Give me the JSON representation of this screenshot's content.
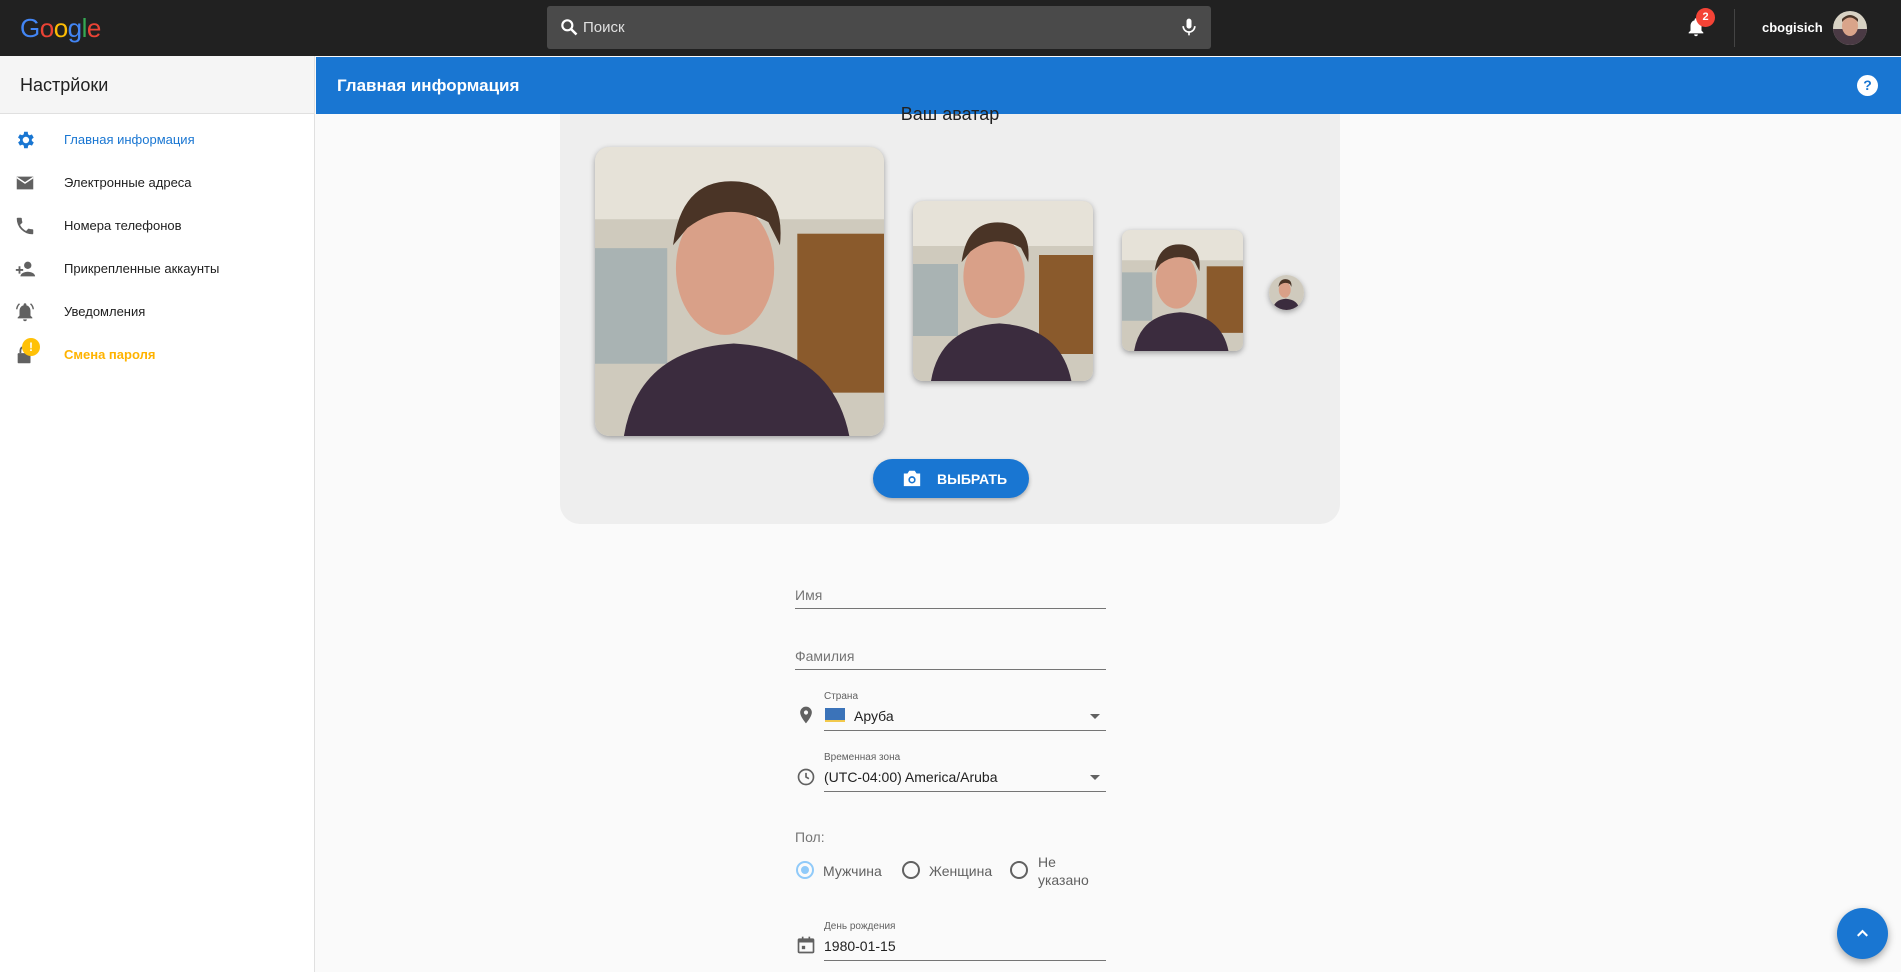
{
  "header": {
    "logo": "Google",
    "search_placeholder": "Поиск",
    "notification_count": "2",
    "username": "cbogisich"
  },
  "sidebar": {
    "title": "Настрйоки",
    "items": [
      {
        "label": "Главная информация",
        "icon": "gear-icon"
      },
      {
        "label": "Электронные адреса",
        "icon": "mail-icon"
      },
      {
        "label": "Номера телефонов",
        "icon": "phone-icon"
      },
      {
        "label": "Прикрепленные аккаунты",
        "icon": "person-add-icon"
      },
      {
        "label": "Уведомления",
        "icon": "bell-ring-icon"
      },
      {
        "label": "Смена пароля",
        "icon": "lock-icon",
        "warning": "!"
      }
    ]
  },
  "page": {
    "title": "Главная информация",
    "help": "?"
  },
  "avatar": {
    "title": "Ваш аватар",
    "choose_label": "ВЫБРАТЬ"
  },
  "form": {
    "first_name_placeholder": "Имя",
    "last_name_placeholder": "Фамилия",
    "country_label": "Страна",
    "country_value": "Аруба",
    "timezone_label": "Временная зона",
    "timezone_value": "(UTC-04:00) America/Aruba",
    "gender_label": "Пол:",
    "gender_options": [
      "Мужчина",
      "Женщина",
      "Не",
      "указано"
    ],
    "gender_selected": "Мужчина",
    "birthday_label": "День рождения",
    "birthday_value": "1980-01-15"
  },
  "colors": {
    "accent": "#1976d2",
    "topbar": "#212121",
    "warning": "#ffb300"
  }
}
